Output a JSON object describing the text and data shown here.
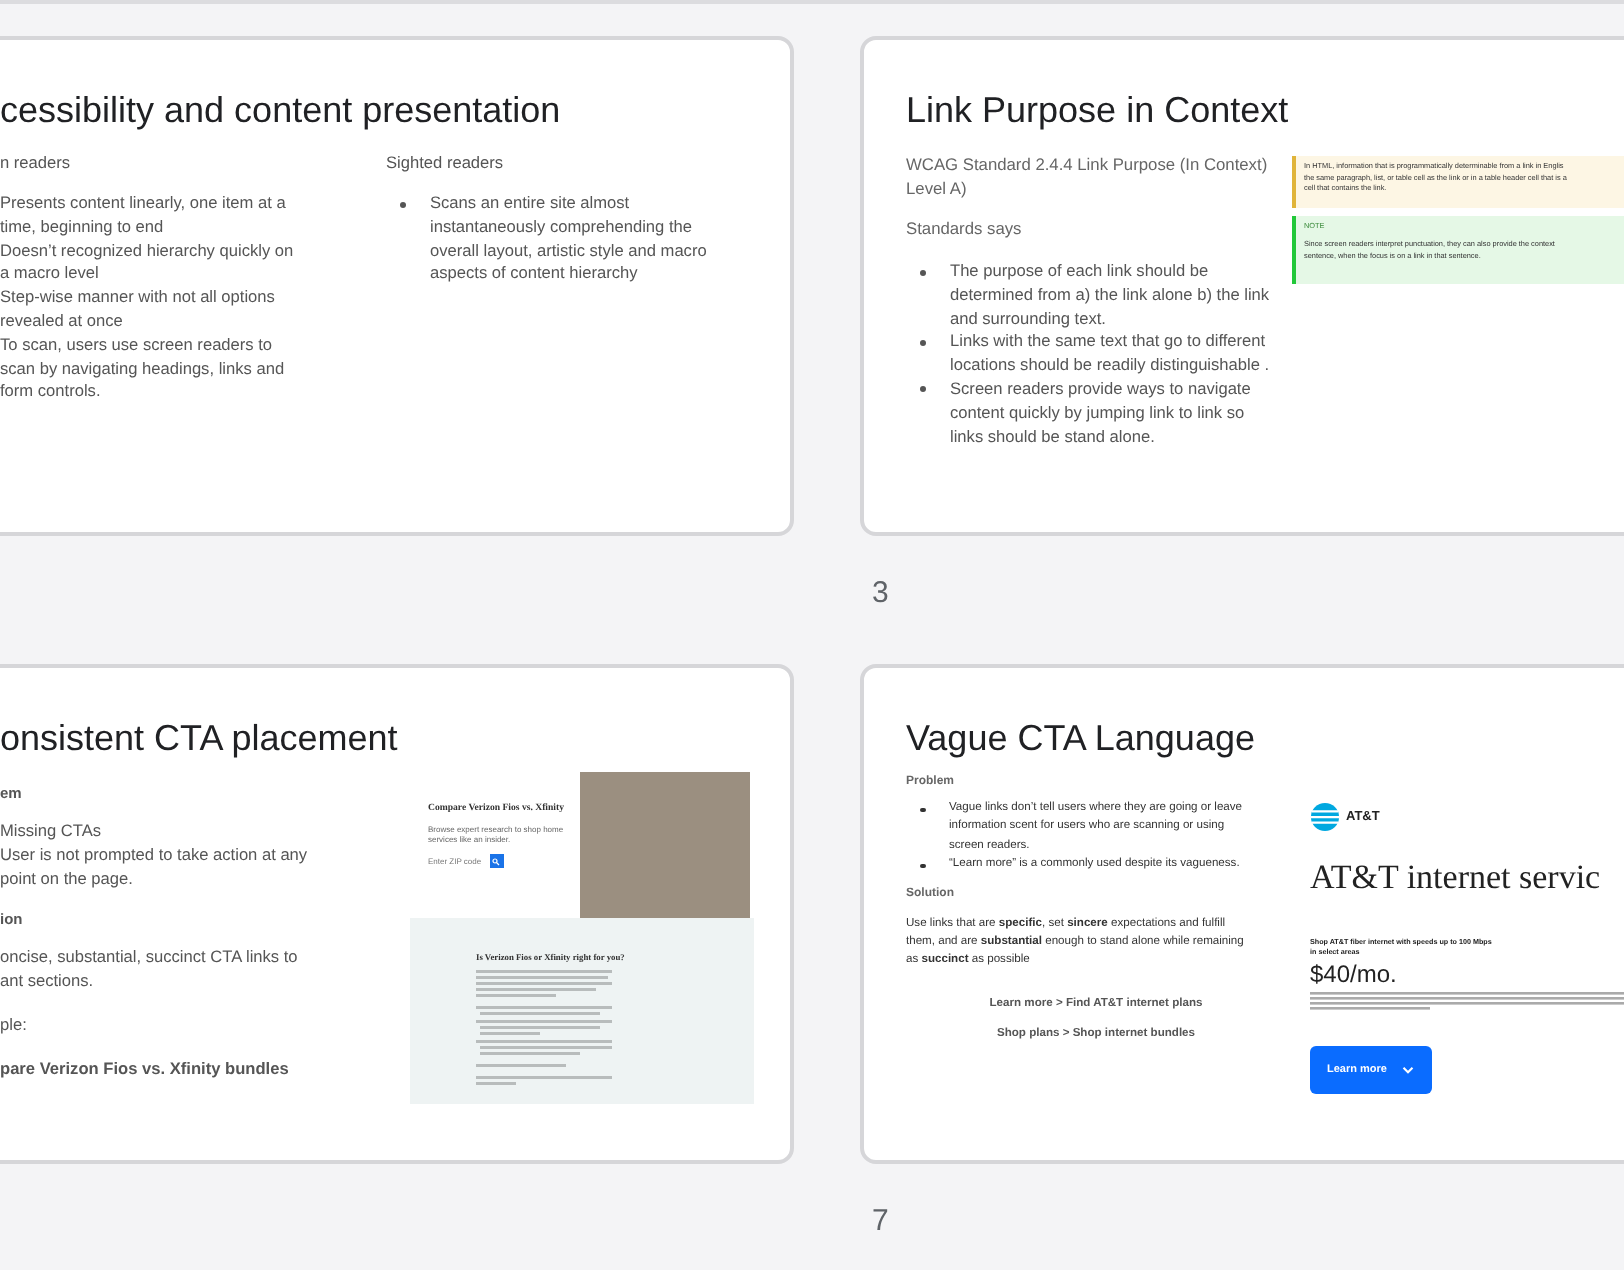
{
  "slides": [
    {
      "kind": "columns",
      "title": "cessibility and content presentation",
      "columns": [
        {
          "heading": "n readers",
          "bullets": false,
          "items": [
            "Presents content linearly, one item at a time, beginning to end",
            "Doesn’t recognized hierarchy quickly on a macro level",
            "Step-wise manner with not all options revealed at once",
            "To scan, users use screen readers to scan by navigating headings, links and form controls."
          ]
        },
        {
          "heading": "Sighted readers",
          "bullets": true,
          "items": [
            "Scans an entire site almost instantaneously comprehending the overall layout, artistic style and macro aspects of content hierarchy"
          ]
        }
      ]
    },
    {
      "kind": "callouts",
      "title": "Link Purpose in Context",
      "number": "3",
      "intro": "WCAG Standard 2.4.4 Link Purpose (In Context) Level A)",
      "subheading": "Standards says",
      "items": [
        "The purpose of each link should  be determined from a) the link alone b) the link and surrounding text.",
        "Links with the same text that go to different locations should be readily distinguishable .",
        "Screen readers provide ways to navigate content quickly by jumping link to link so links should be stand alone."
      ],
      "callouts": [
        {
          "kind": "info",
          "lines": [
            "In HTML, information that is programmatically determinable from a link in Englis",
            "the same paragraph, list, or table cell as the link or in a table header cell that is a",
            "cell that contains the link."
          ]
        },
        {
          "kind": "note",
          "label": "NOTE",
          "lines": [
            "Since screen readers interpret punctuation, they can also provide the context",
            "sentence, when the focus is on a link in that sentence."
          ]
        }
      ]
    },
    {
      "kind": "example-page",
      "title": "onsistent CTA placement",
      "problem_heading": "em",
      "problem_items": [
        "Missing CTAs",
        "User is not prompted to take action at any point on the page."
      ],
      "solution_heading": "ion",
      "solution_text": "oncise, substantial, succinct CTA links to ant sections.",
      "example_label": "ple:",
      "example_link": "pare Verizon Fios vs. Xfinity bundles",
      "screenshot": {
        "heading": "Compare Verizon Fios vs. Xfinity",
        "subtitle": "Browse expert research to shop home services like an insider.",
        "zip_placeholder": "Enter ZIP code",
        "section_heading": "Is Verizon Fios or Xfinity right for you?"
      }
    },
    {
      "kind": "example-ad",
      "title": "Vague CTA Language",
      "number": "7",
      "problem_heading": "Problem",
      "problem_items": [
        "Vague links don’t tell users where they are going or leave information scent for users who are scanning or using screen readers.",
        "“Learn more” is a commonly used despite its vagueness."
      ],
      "solution_heading": "Solution",
      "solution_text": "Use links that are **specific**, set **sincere** expectations and fulfill them, and are **substantial** enough to stand alone while remaining as **succinct** as possible",
      "links": [
        "Learn more > Find AT&T internet plans",
        "Shop plans > Shop internet bundles"
      ],
      "ad": {
        "brand": "AT&T",
        "heading": "AT&T internet servic",
        "promo": "Shop AT&T fiber internet with speeds up to 100 Mbps in select areas",
        "price": "$40/mo.",
        "button": "Learn more"
      }
    }
  ]
}
